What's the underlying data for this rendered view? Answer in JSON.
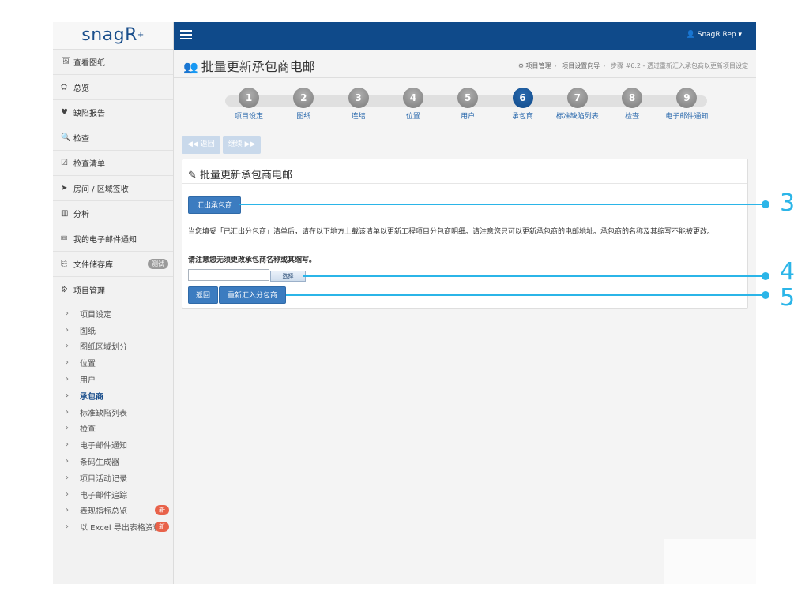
{
  "app": {
    "logo": "snagR"
  },
  "topbar": {
    "user": "SnagR Rep ▾"
  },
  "sidebar": {
    "items": [
      {
        "icon": "🖼",
        "label": "查看图纸"
      },
      {
        "icon": "⛭",
        "label": "总览"
      },
      {
        "icon": "♥",
        "label": "缺陷报告"
      },
      {
        "icon": "🔍",
        "label": "检查"
      },
      {
        "icon": "☑",
        "label": "检查清单"
      },
      {
        "icon": "➤",
        "label": "房间 / 区域签收"
      },
      {
        "icon": "▥",
        "label": "分析"
      },
      {
        "icon": "✉",
        "label": "我的电子邮件通知"
      },
      {
        "icon": "⎘",
        "label": "文件储存库",
        "badge": "测试"
      },
      {
        "icon": "⚙",
        "label": "项目管理"
      }
    ],
    "sub_items": [
      {
        "label": "项目设定"
      },
      {
        "label": "图纸"
      },
      {
        "label": "图纸区域划分"
      },
      {
        "label": "位置"
      },
      {
        "label": "用户"
      },
      {
        "label": "承包商",
        "active": true
      },
      {
        "label": "标准缺陷列表"
      },
      {
        "label": "检查"
      },
      {
        "label": "电子邮件通知"
      },
      {
        "label": "条码生成器"
      },
      {
        "label": "项目活动记录"
      },
      {
        "label": "电子邮件追踪"
      },
      {
        "label": "表现指标总览",
        "badge": "新"
      },
      {
        "label": "以 Excel 导出表格资料",
        "badge": "新"
      }
    ]
  },
  "page": {
    "title": "批量更新承包商电邮",
    "breadcrumb": [
      "项目管理",
      "项目设置向导",
      "步骤 #6.2 - 透过重新汇入承包商以更新项目设定"
    ]
  },
  "wizard": {
    "steps": [
      {
        "num": "1",
        "label": "项目设定"
      },
      {
        "num": "2",
        "label": "图纸"
      },
      {
        "num": "3",
        "label": "连结"
      },
      {
        "num": "4",
        "label": "位置"
      },
      {
        "num": "5",
        "label": "用户"
      },
      {
        "num": "6",
        "label": "承包商",
        "active": true
      },
      {
        "num": "7",
        "label": "标准缺陷列表"
      },
      {
        "num": "8",
        "label": "检查"
      },
      {
        "num": "9",
        "label": "电子邮件通知"
      }
    ],
    "back_label": "◀◀ 返回",
    "next_label": "继续 ▶▶"
  },
  "panel": {
    "title": "批量更新承包商电邮",
    "export_label": "汇出承包商",
    "info": "当您填妥「已汇出分包商」清单后，请在以下地方上载该清单以更新工程项目分包商明细。请注意您只可以更新承包商的电邮地址。承包商的名称及其缩写不能被更改。",
    "note": "请注意您无须更改承包商名称或其缩写。",
    "browse_label": "选择",
    "back_label": "返回",
    "reimport_label": "重新汇入分包商"
  },
  "callouts": [
    "3",
    "4",
    "5"
  ],
  "colors": {
    "brand": "#0f4a8a",
    "button": "#3c7cc0",
    "callout": "#2bb5e8",
    "badge_new": "#e8624a"
  }
}
